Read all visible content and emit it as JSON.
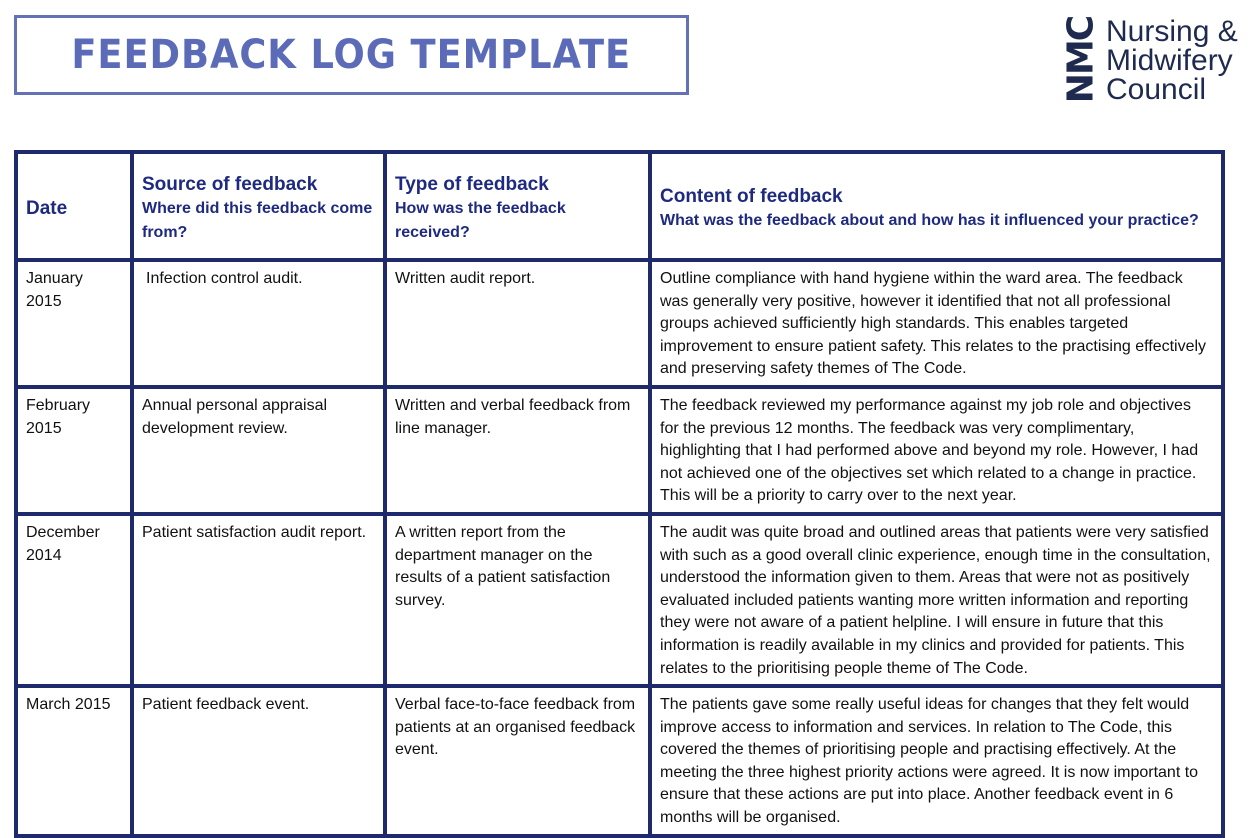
{
  "title": "FEEDBACK LOG TEMPLATE",
  "logo": {
    "mark": "NMC",
    "lines": [
      "Nursing &",
      "Midwifery",
      "Council"
    ],
    "color": "#1f2a4f"
  },
  "colors": {
    "title": "#5b6bb8",
    "table_border": "#1e2a6b",
    "header_text": "#1e2a80"
  },
  "table": {
    "headers": [
      {
        "title": "Date",
        "subtitle": ""
      },
      {
        "title": "Source of feedback",
        "subtitle": "Where did this feedback come from?"
      },
      {
        "title": "Type of feedback",
        "subtitle": "How was the feedback received?"
      },
      {
        "title": "Content of feedback",
        "subtitle": "What was the feedback about and how has it influenced your practice?"
      }
    ],
    "rows": [
      {
        "date": "January 2015",
        "source": "Infection control audit.",
        "type": "Written audit report.",
        "content": "Outline compliance with hand hygiene within the ward area. The feedback was generally very positive, however it identified that not all professional groups achieved sufficiently high standards. This enables targeted improvement to ensure patient safety. This relates to the practising effectively and preserving safety themes of The Code."
      },
      {
        "date": "February 2015",
        "source": "Annual personal appraisal development review.",
        "type": "Written and verbal feedback from line manager.",
        "content": "The feedback reviewed my performance against my job role and objectives for the previous 12 months. The feedback was very complimentary, highlighting that I had performed above and beyond my role. However, I had not achieved one of the objectives set which related to a change in practice. This will be a priority to carry over to the next year."
      },
      {
        "date": "December 2014",
        "source": "Patient satisfaction audit report.",
        "type": "A written report from the department manager on the results of a patient satisfaction survey.",
        "content": "The audit was quite broad and outlined areas that patients were very satisfied with such as a good overall clinic experience, enough time in the consultation, understood the information given to them. Areas that were not as positively evaluated included patients wanting more written information and reporting they were not aware of a patient helpline. I will ensure in future that this information is readily available in my clinics and provided for patients. This relates to the prioritising people theme of The Code."
      },
      {
        "date": "March 2015",
        "source": "Patient feedback event.",
        "type": "Verbal face-to-face feedback from patients at an organised feedback event.",
        "content": "The patients gave some really useful ideas for changes that they felt would improve access to information and services. In relation to The Code, this covered the themes of prioritising people and practising effectively. At the meeting the three highest priority actions were agreed. It is now important to ensure that these actions are put into place. Another feedback event in 6 months will be organised."
      }
    ]
  }
}
